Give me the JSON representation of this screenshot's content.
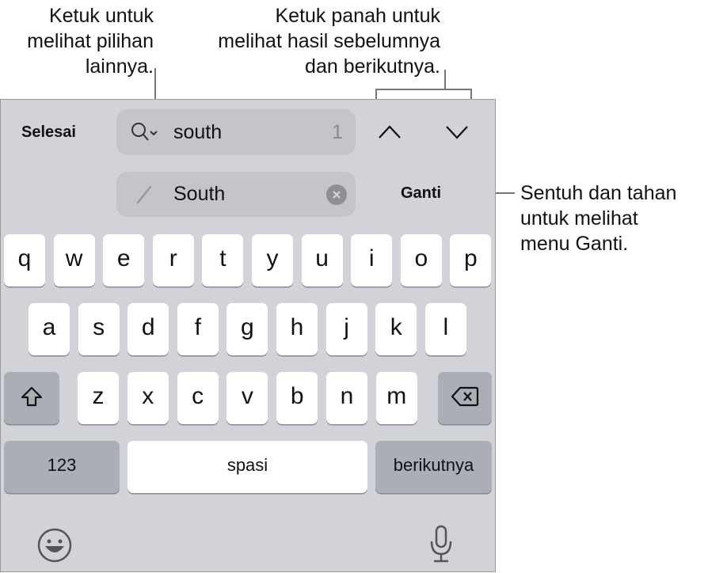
{
  "annotations": {
    "options": [
      "Ketuk untuk",
      "melihat pilihan",
      "lainnya."
    ],
    "arrows": [
      "Ketuk panah untuk",
      "melihat hasil sebelumnya",
      "dan berikutnya."
    ],
    "replace": [
      "Sentuh dan tahan",
      "untuk melihat",
      "menu Ganti."
    ]
  },
  "toolbar": {
    "done_label": "Selesai",
    "search_value": "south",
    "match_count": "1",
    "replace_value": "South",
    "replace_label": "Ganti"
  },
  "keyboard": {
    "row1": [
      "q",
      "w",
      "e",
      "r",
      "t",
      "y",
      "u",
      "i",
      "o",
      "p"
    ],
    "row2": [
      "a",
      "s",
      "d",
      "f",
      "g",
      "h",
      "j",
      "k",
      "l"
    ],
    "row3": [
      "z",
      "x",
      "c",
      "v",
      "b",
      "n",
      "m"
    ],
    "numbers_label": "123",
    "space_label": "spasi",
    "next_label": "berikutnya"
  }
}
